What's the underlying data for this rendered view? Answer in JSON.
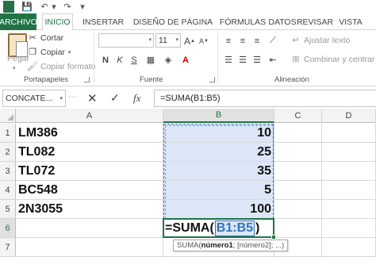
{
  "titlebar": {
    "app_icon": "X",
    "save": "💾",
    "undo": "↶",
    "undo_more": "▾",
    "redo": "↷",
    "qa_more": "▾"
  },
  "tabs": [
    {
      "label": "ARCHIVO"
    },
    {
      "label": "INICIO"
    },
    {
      "label": "INSERTAR"
    },
    {
      "label": "DISEÑO DE PÁGINA"
    },
    {
      "label": "FÓRMULAS"
    },
    {
      "label": "DATOS"
    },
    {
      "label": "REVISAR"
    },
    {
      "label": "VISTA"
    }
  ],
  "ribbon": {
    "clipboard": {
      "paste": "Pegar",
      "cut": "Cortar",
      "copy": "Copiar",
      "copy_format": "Copiar formato",
      "group_label": "Portapapeles"
    },
    "font": {
      "font_name": "",
      "font_size": "11",
      "bold": "N",
      "italic": "K",
      "underline": "S",
      "grow": "A",
      "shrink": "A",
      "group_label": "Fuente"
    },
    "alignment": {
      "wrap_text": "Ajustar texto",
      "merge_center": "Combinar y centrar",
      "group_label": "Alineación"
    }
  },
  "formula_bar": {
    "name_box": "CONCATE...",
    "cancel": "✕",
    "enter": "✓",
    "fx": "fx",
    "value": "=SUMA(B1:B5)"
  },
  "grid": {
    "columns": [
      "A",
      "B",
      "C",
      "D"
    ],
    "rows": [
      "1",
      "2",
      "3",
      "4",
      "5",
      "6",
      "7"
    ],
    "cells_a": [
      "LM386",
      "TL082",
      "TL072",
      "BC548",
      "2N3055"
    ],
    "cells_b": [
      "10",
      "25",
      "35",
      "5",
      "100"
    ],
    "active_formula": {
      "prefix": "=SUMA(",
      "ref": "B1:B5",
      "suffix": ")"
    },
    "tooltip": {
      "func": "SUMA(",
      "arg1": "número1",
      "rest": "; [número2]; ...)"
    }
  },
  "colors": {
    "accent": "#217346",
    "range_highlight": "#dce6f7",
    "reference_blue": "#2e75b6"
  }
}
